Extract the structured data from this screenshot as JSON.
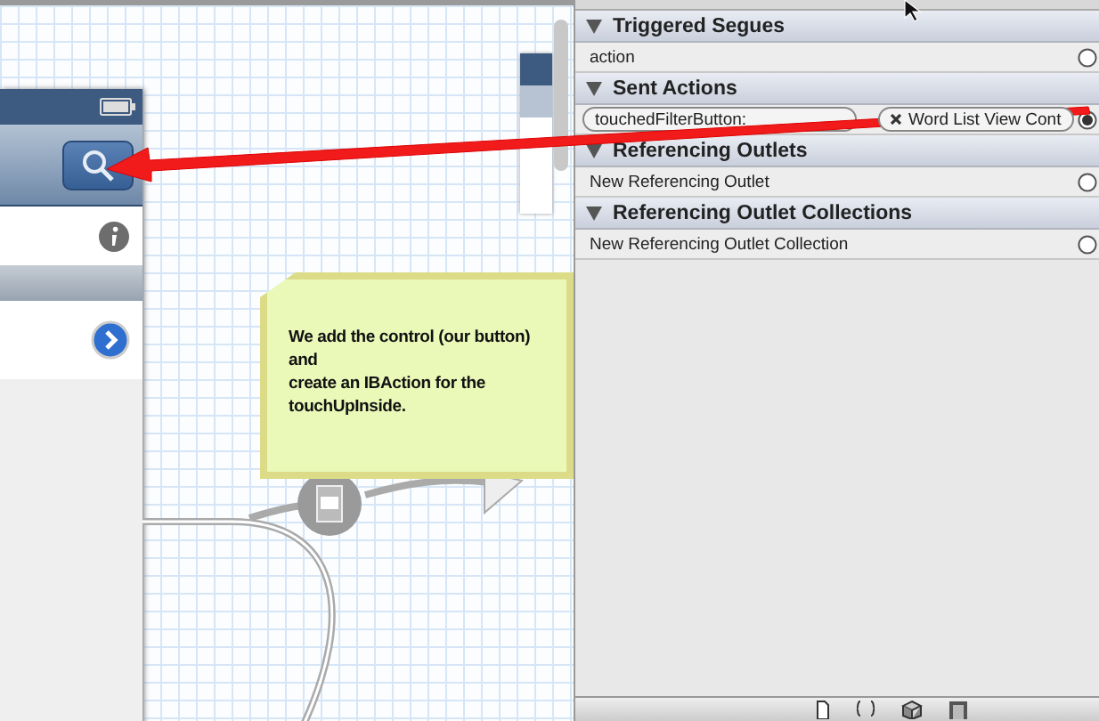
{
  "inspector": {
    "sections": [
      {
        "title": "Triggered Segues",
        "expanded": true,
        "rows": [
          {
            "kind": "plain",
            "label": "action",
            "connected": false
          }
        ]
      },
      {
        "title": "Sent Actions",
        "expanded": true,
        "rows": [
          {
            "kind": "connection",
            "label": "touchedFilterButton:",
            "target": "Word List View Cont",
            "connected": true
          }
        ]
      },
      {
        "title": "Referencing Outlets",
        "expanded": true,
        "rows": [
          {
            "kind": "plain",
            "label": "New Referencing Outlet",
            "connected": false
          }
        ]
      },
      {
        "title": "Referencing Outlet Collections",
        "expanded": true,
        "rows": [
          {
            "kind": "plain",
            "label": "New Referencing Outlet Collection",
            "connected": false
          }
        ]
      }
    ]
  },
  "note": {
    "lines": [
      "We add the control (our button) and",
      "create an IBAction for the touchUpInside."
    ]
  }
}
